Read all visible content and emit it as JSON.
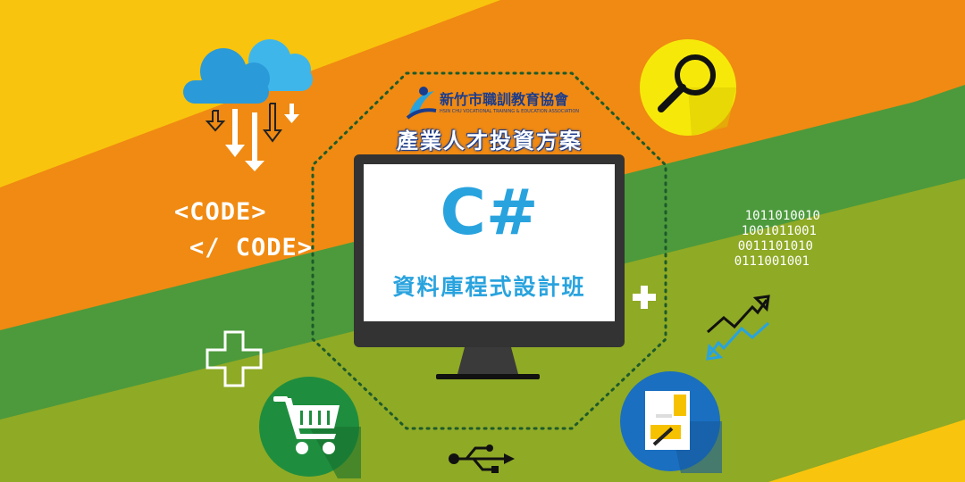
{
  "organization": {
    "name": "新竹市職訓教育協會",
    "name_en": "HSIN CHU VOCATIONAL TRAINING & EDUCATION ASSOCIATION"
  },
  "program": "產業人才投資方案",
  "course": {
    "title": "C#",
    "subtitle": "資料庫程式設計班"
  },
  "code_lines": [
    "<CODE>",
    "</ CODE>"
  ],
  "binary_lines": [
    "1011010010",
    "1001011001",
    "0011101010",
    "0111001001"
  ],
  "icons": [
    "cloud-icon",
    "download-arrows-icon",
    "plus-icon",
    "shopping-cart-icon",
    "magnifier-icon",
    "trend-arrows-icon",
    "document-pen-icon",
    "usb-icon"
  ],
  "colors": {
    "orange": "#f08a12",
    "yellow": "#f9c40d",
    "green": "#4c9a3c",
    "olive": "#8faa25",
    "accent_blue": "#29a3de",
    "dark_blue": "#1b3c8c"
  }
}
